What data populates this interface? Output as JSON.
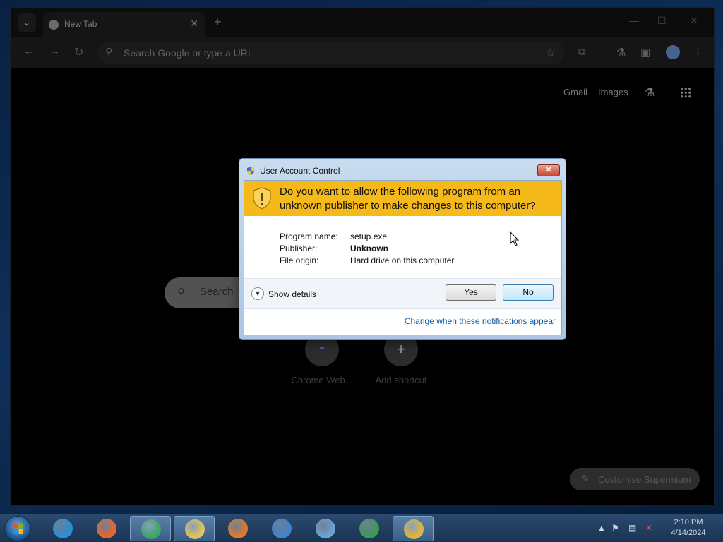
{
  "browser": {
    "tab_title": "New Tab",
    "omnibox_placeholder": "Search Google or type a URL",
    "ntp": {
      "gmail": "Gmail",
      "images": "Images",
      "search_placeholder": "Search",
      "shortcuts": [
        {
          "label": "Chrome Web...",
          "icon": "chrome-web-store-icon"
        },
        {
          "label": "Add shortcut",
          "icon": "plus-icon"
        }
      ],
      "customise_label": "Customise Supermium"
    }
  },
  "uac": {
    "title": "User Account Control",
    "question": "Do you want to allow the following program from an unknown publisher to make changes to this computer?",
    "info": [
      {
        "label": "Program name:",
        "value": "setup.exe"
      },
      {
        "label": "Publisher:",
        "value": "Unknown"
      },
      {
        "label": "File origin:",
        "value": "Hard drive on this computer"
      }
    ],
    "show_details": "Show details",
    "yes_label": "Yes",
    "no_label": "No",
    "change_link": "Change when these notifications appear",
    "close_glyph": "✕"
  },
  "taskbar": {
    "items": [
      {
        "icon": "internet-explorer-icon",
        "color": "#2b8ed6"
      },
      {
        "icon": "firefox-icon",
        "color": "#e8652b"
      },
      {
        "icon": "chrome-icon",
        "color": "#3aa864"
      },
      {
        "icon": "file-explorer-icon",
        "color": "#e2c25a"
      },
      {
        "icon": "media-player-icon",
        "color": "#e07a2a"
      },
      {
        "icon": "windows-icon",
        "color": "#3f83c9"
      },
      {
        "icon": "control-panel-icon",
        "color": "#6fa1d1"
      },
      {
        "icon": "network-icon",
        "color": "#3c9a52"
      },
      {
        "icon": "uac-shield-icon",
        "color": "#e2b53a"
      }
    ],
    "time": "2:10 PM",
    "date": "4/14/2024"
  }
}
